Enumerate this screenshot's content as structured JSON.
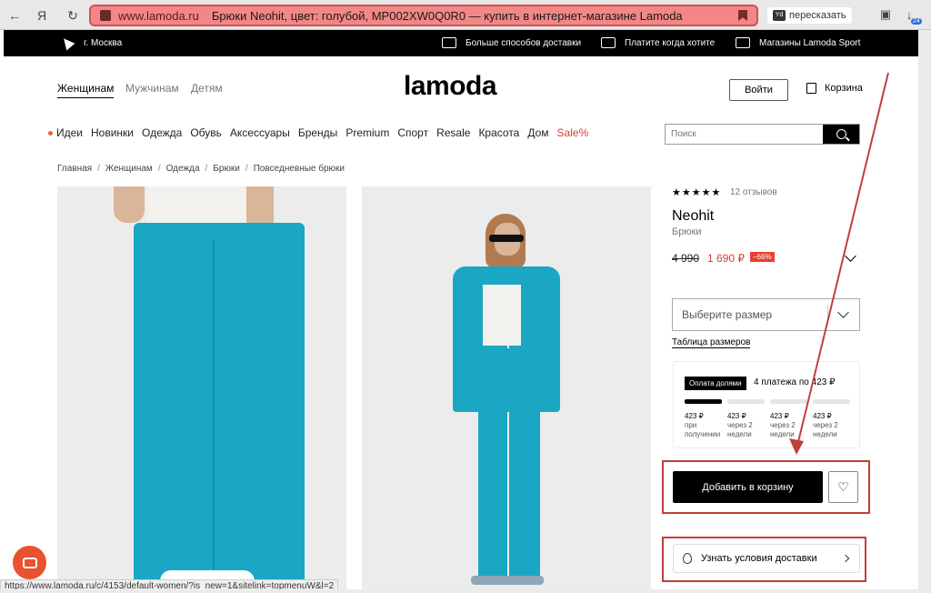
{
  "browser": {
    "domain": "www.lamoda.ru",
    "page_title": "Брюки Neohit, цвет: голубой, MP002XW0Q0R0 — купить в интернет-магазине Lamoda",
    "translate_label": "пересказать",
    "downloads_count": "24"
  },
  "topbar": {
    "city": "г. Москва",
    "delivery": "Больше способов доставки",
    "pay": "Платите когда хотите",
    "stores": "Магазины Lamoda Sport"
  },
  "header": {
    "genders": [
      "Женщинам",
      "Мужчинам",
      "Детям"
    ],
    "logo": "lamoda",
    "login": "Войти",
    "cart": "Корзина"
  },
  "catnav": [
    "Идеи",
    "Новинки",
    "Одежда",
    "Обувь",
    "Аксессуары",
    "Бренды",
    "Premium",
    "Спорт",
    "Resale",
    "Красота",
    "Дом",
    "Sale%"
  ],
  "search": {
    "placeholder": "Поиск"
  },
  "breadcrumbs": [
    "Главная",
    "Женщинам",
    "Одежда",
    "Брюки",
    "Повседневные брюки"
  ],
  "product": {
    "stars": "★★★★★",
    "reviews": "12 отзывов",
    "brand": "Neohit",
    "category": "Брюки",
    "old_price": "4 990",
    "new_price": "1 690 ₽",
    "discount": "−66%",
    "size_placeholder": "Выберите размер",
    "size_table": "Таблица размеров",
    "add_to_cart": "Добавить в корзину",
    "delivery_terms": "Узнать условия доставки"
  },
  "installments": {
    "badge": "Оплата долями",
    "summary": "4 платежа по 423 ₽",
    "payments": [
      {
        "amount": "423 ₽",
        "when": "при получении"
      },
      {
        "amount": "423 ₽",
        "when": "через 2 недели"
      },
      {
        "amount": "423 ₽",
        "when": "через 2 недели"
      },
      {
        "amount": "423 ₽",
        "when": "через 2 недели"
      }
    ]
  },
  "status_url": "https://www.lamoda.ru/c/4153/default-women/?is_new=1&sitelink=topmenuW&l=2",
  "colors": {
    "accent": "#e03a2e",
    "product": "#19a7c3",
    "highlight": "#c0403a"
  }
}
